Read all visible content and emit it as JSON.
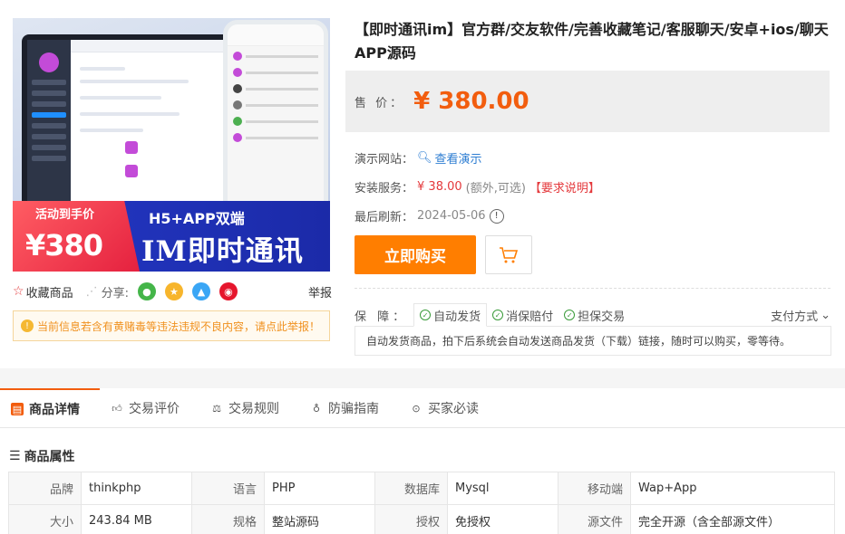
{
  "product_image": {
    "promo_label": "活动到手价",
    "promo_price": "¥380",
    "tagline": "H5+APP双端",
    "headline": "IM即时通讯"
  },
  "title": "【即时通讯im】官方群/交友软件/完善收藏笔记/客服聊天/安卓+ios/聊天APP源码",
  "price": {
    "label": "售 价：",
    "value": "¥ 380.00"
  },
  "demo": {
    "label": "演示网站：",
    "link": "查看演示"
  },
  "install": {
    "label": "安装服务：",
    "price": "¥ 38.00",
    "note": "(额外,可选)",
    "req": "【要求说明】"
  },
  "refresh": {
    "label": "最后刷新：",
    "date": "2024-05-06"
  },
  "buy_label": "立即购买",
  "tools": {
    "favorite": "收藏商品",
    "share": "分享:",
    "report": "举报"
  },
  "notice": "当前信息若含有黄赌毒等违法违规不良内容，请点此举报！",
  "guarantee": {
    "label": "保 障：",
    "items": [
      "自动发货",
      "消保赔付",
      "担保交易"
    ],
    "pay": "支付方式",
    "desc": "自动发货商品，拍下后系统会自动发送商品发货（下载）链接，随时可以购买，零等待。"
  },
  "tabs": [
    "商品详情",
    "交易评价",
    "交易规则",
    "防骗指南",
    "买家必读"
  ],
  "attr_title": "商品属性",
  "attrs": [
    [
      [
        "品牌",
        "thinkphp"
      ],
      [
        "语言",
        "PHP"
      ],
      [
        "数据库",
        "Mysql"
      ],
      [
        "移动端",
        "Wap+App"
      ]
    ],
    [
      [
        "大小",
        "243.84 MB"
      ],
      [
        "规格",
        "整站源码"
      ],
      [
        "授权",
        "免授权"
      ],
      [
        "源文件",
        "完全开源（含全部源文件）"
      ]
    ]
  ],
  "colors": {
    "accent": "#ff7e00",
    "price": "#f25d0e",
    "link": "#2d7dd2",
    "warn": "#e4393c"
  }
}
